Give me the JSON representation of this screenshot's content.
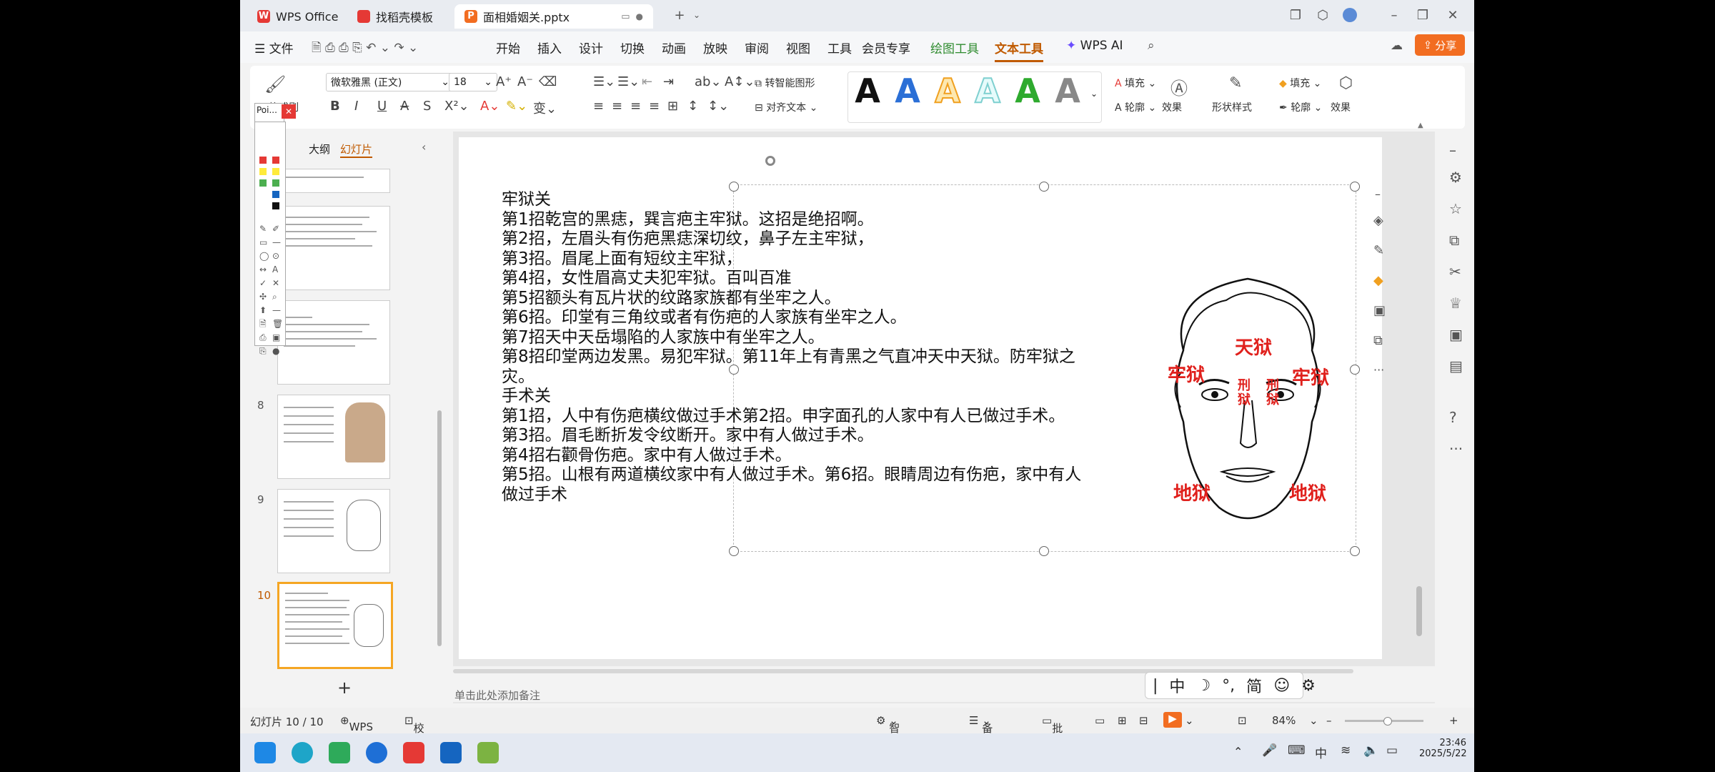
{
  "titlebar": {
    "tabs": [
      {
        "label": "WPS Office"
      },
      {
        "label": "找稻壳模板"
      },
      {
        "label": "面相婚姻关.pptx"
      }
    ]
  },
  "menubar": {
    "file": "文件",
    "items": [
      "开始",
      "插入",
      "设计",
      "切换",
      "动画",
      "放映",
      "审阅",
      "视图",
      "工具",
      "会员专享"
    ],
    "draw_tools": "绘图工具",
    "text_tools": "文本工具",
    "wps_ai": "WPS AI",
    "share": "分享"
  },
  "ribbon": {
    "format_painter": "格式刷",
    "font_name": "微软雅黑 (正文)",
    "font_size": "18",
    "smart_shape": "转智能图形",
    "align_text": "对齐文本",
    "fill": "填充",
    "outline": "轮廓",
    "effect": "效果",
    "shape_style": "形状样式",
    "fill2": "填充",
    "outline2": "轮廓",
    "effect2": "效果",
    "art_letter": "A",
    "art_colors": [
      "#111111",
      "#2b6fd6",
      "#f0a020",
      "#7fd0d0",
      "#2eaa2e",
      "#888888"
    ]
  },
  "palette": {
    "title": "Poi...",
    "colors": [
      "#e53935",
      "#e53935",
      "#ffeb3b",
      "#4caf50",
      "#4caf50",
      "#1565c0",
      "#1565c0",
      "#111111"
    ]
  },
  "leftpanel": {
    "outline_tab": "大纲",
    "slides_tab": "幻灯片",
    "thumbs": [
      {
        "num": ""
      },
      {
        "num": ""
      },
      {
        "num": ""
      },
      {
        "num": "8"
      },
      {
        "num": "9"
      },
      {
        "num": "10"
      }
    ],
    "add": "+"
  },
  "slide": {
    "lines": [
      "牢狱关",
      "第1招乾宫的黑痣，巽言疤主牢狱。这招是绝招啊。",
      "第2招，左眉头有伤疤黑痣深切纹，鼻子左主牢狱，",
      "第3招。眉尾上面有短纹主牢狱，",
      "第4招，女性眉高丈夫犯牢狱。百叫百准",
      "第5招额头有瓦片状的纹路家族都有坐牢之人。",
      "第6招。印堂有三角纹或者有伤疤的人家族有坐牢之人。",
      "第7招天中天岳塌陷的人家族中有坐牢之人。",
      "第8招印堂两边发黑。易犯牢狱。第11年上有青黑之气直冲天中天狱。防牢狱之",
      "灾。",
      "手术关",
      "第1招，人中有伤疤横纹做过手术第2招。申字面孔的人家中有人已做过手术。",
      "第3招。眉毛断折发令纹断开。家中有人做过手术。",
      "第4招右颧骨伤疤。家中有人做过手术。",
      "第5招。山根有两道横纹家中有人做过手术。第6招。眼睛周边有伤疤，家中有人",
      "做过手术"
    ],
    "face_labels": {
      "top": "天狱",
      "left_upper": "牢狱",
      "right_upper": "牢狱",
      "xing1": "刑狱",
      "xing2": "刑狱",
      "left_lower": "地狱",
      "right_lower": "地狱"
    },
    "notes_placeholder": "单击此处添加备注"
  },
  "ime": {
    "items": [
      "|",
      "中",
      "☽",
      "°,",
      "简",
      "☺",
      "⚙"
    ]
  },
  "status": {
    "slide_count": "幻灯片 10 / 10",
    "wps": "WPS",
    "proof": "校对",
    "beautify": "智能美化",
    "notes": "备注",
    "comment": "批注",
    "zoom": "84%"
  },
  "taskbar": {
    "time": "23:46",
    "date": "2025/5/22",
    "ime": "中"
  }
}
